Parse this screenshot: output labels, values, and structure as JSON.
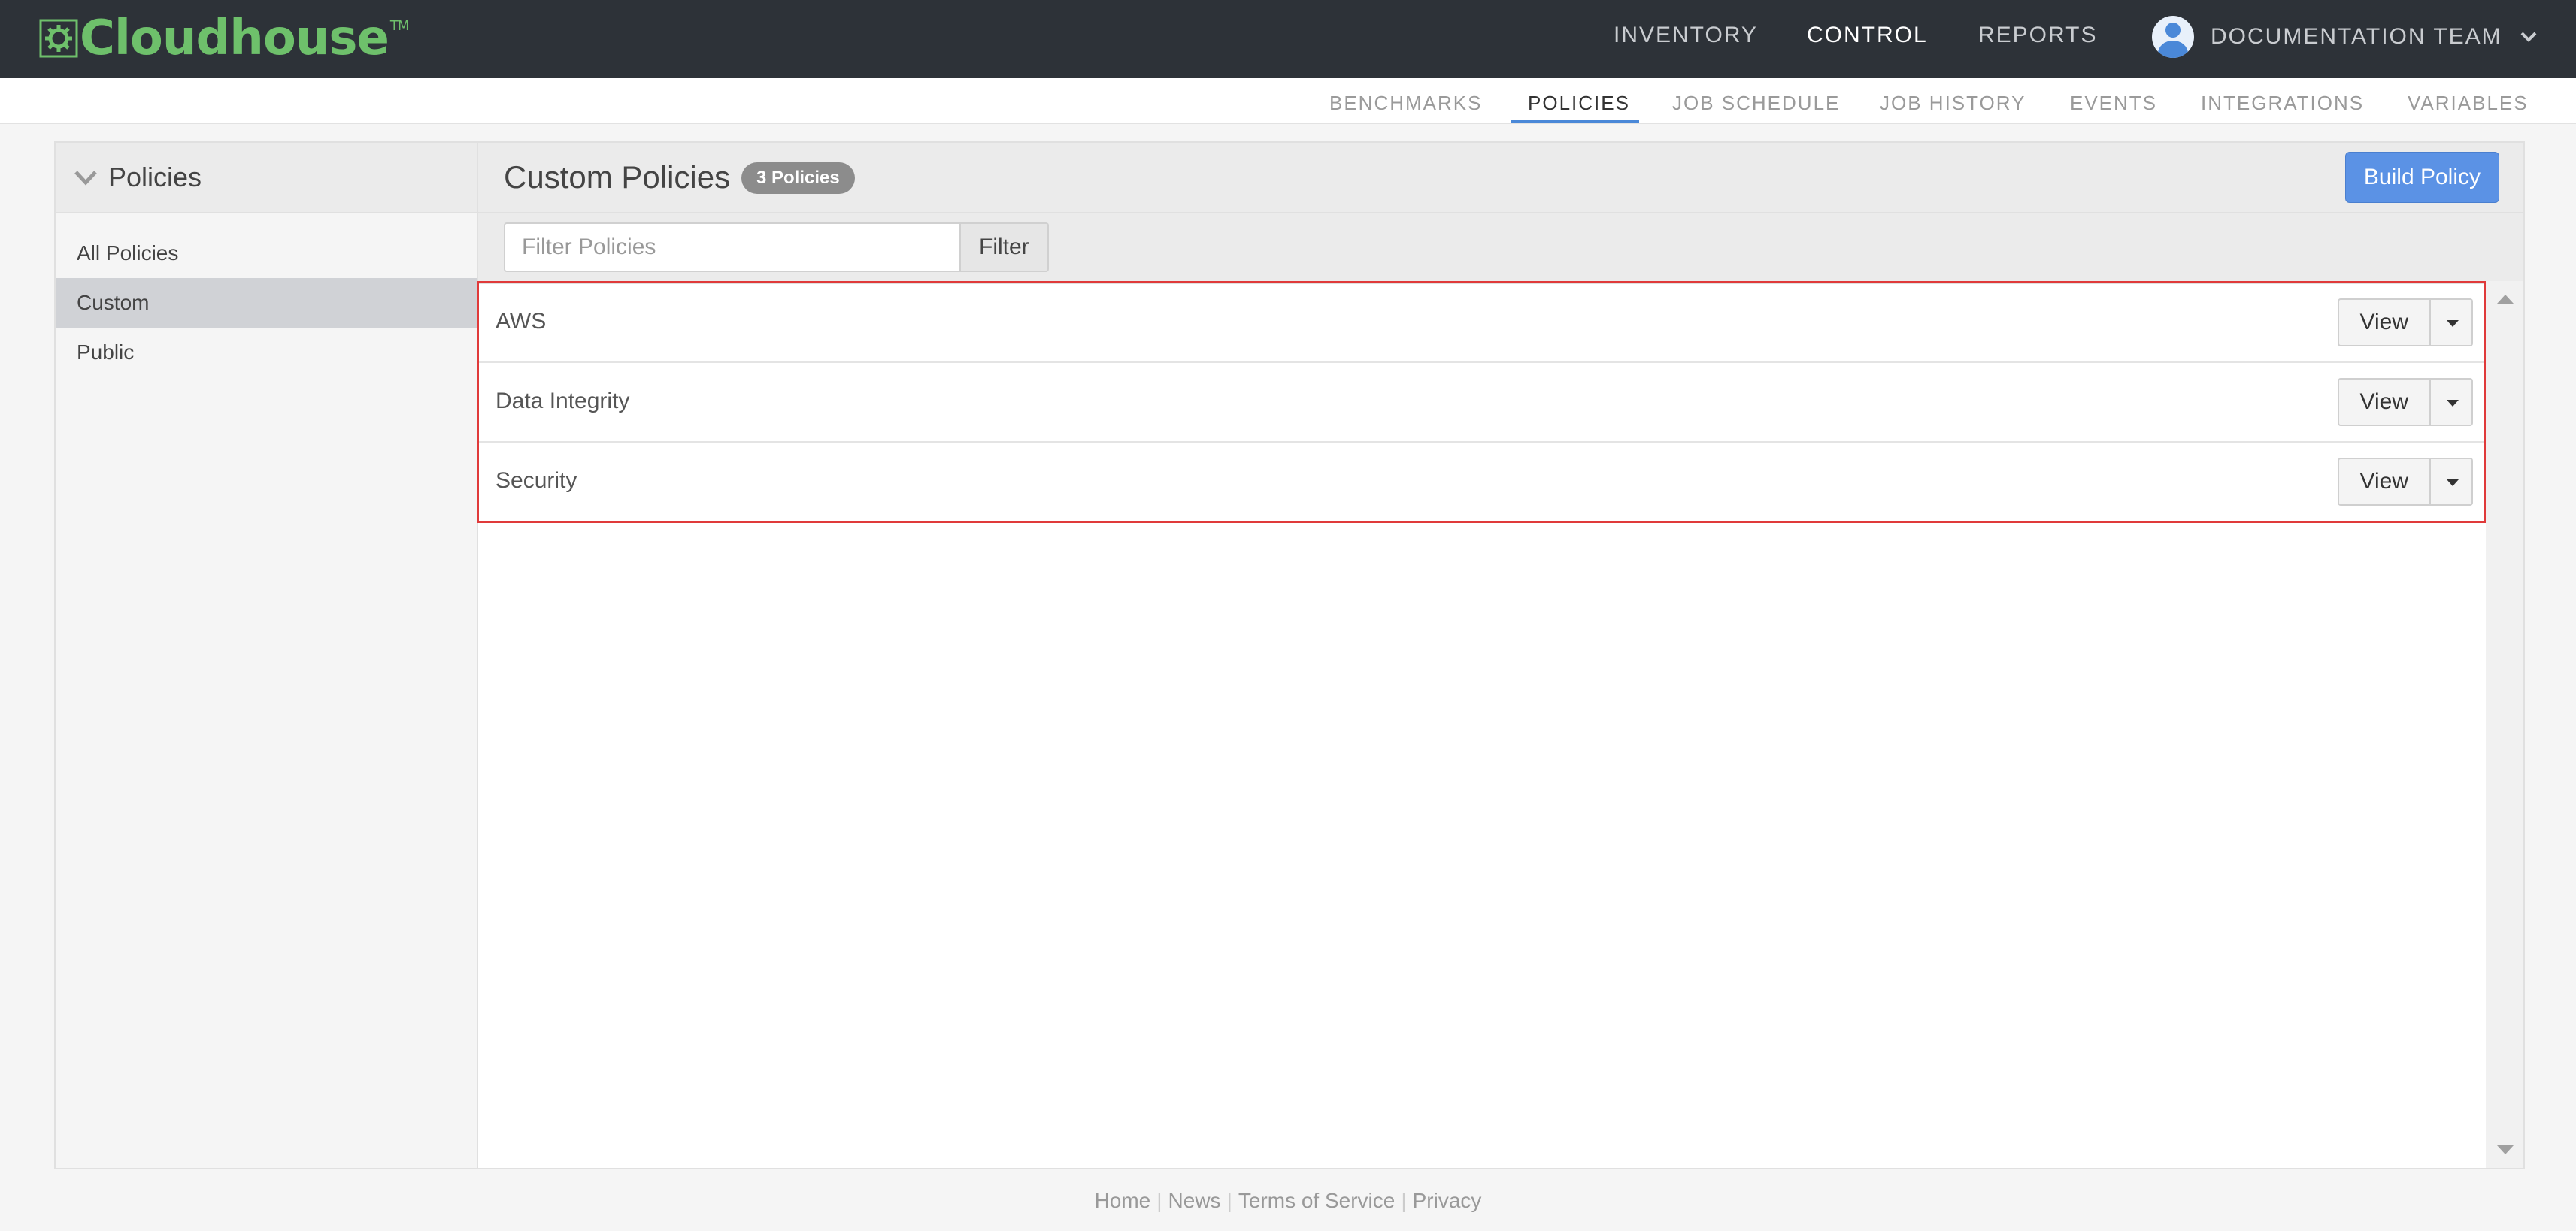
{
  "brand": {
    "name": "Cloudhouse",
    "tm": "TM",
    "logo_icon": "gear-icon",
    "color": "#6ec06b"
  },
  "topnav": {
    "items": [
      {
        "label": "INVENTORY"
      },
      {
        "label": "CONTROL",
        "active": true
      },
      {
        "label": "REPORTS"
      }
    ]
  },
  "user": {
    "team": "DOCUMENTATION TEAM",
    "avatar_icon": "user-avatar-icon",
    "menu_icon": "chevron-down-icon"
  },
  "subnav": {
    "items": [
      {
        "label": "BENCHMARKS"
      },
      {
        "label": "POLICIES",
        "active": true
      },
      {
        "label": "JOB SCHEDULE"
      },
      {
        "label": "JOB HISTORY"
      },
      {
        "label": "EVENTS"
      },
      {
        "label": "INTEGRATIONS"
      },
      {
        "label": "VARIABLES"
      }
    ],
    "accent": "#4a88d8"
  },
  "sidebar": {
    "title": "Policies",
    "collapse_icon": "chevron-down-icon",
    "items": [
      {
        "label": "All Policies"
      },
      {
        "label": "Custom",
        "selected": true
      },
      {
        "label": "Public"
      }
    ]
  },
  "main": {
    "title": "Custom Policies",
    "count_badge": "3 Policies",
    "build_button": "Build Policy",
    "build_button_color": "#5b92e5",
    "filter": {
      "placeholder": "Filter Policies",
      "value": "",
      "button": "Filter"
    },
    "policies": [
      {
        "name": "AWS",
        "view_label": "View"
      },
      {
        "name": "Data Integrity",
        "view_label": "View"
      },
      {
        "name": "Security",
        "view_label": "View"
      }
    ],
    "highlight_color": "#e03a3a"
  },
  "footer": {
    "links": [
      {
        "label": "Home"
      },
      {
        "label": "News"
      },
      {
        "label": "Terms of Service"
      },
      {
        "label": "Privacy"
      }
    ],
    "separator": "|"
  }
}
